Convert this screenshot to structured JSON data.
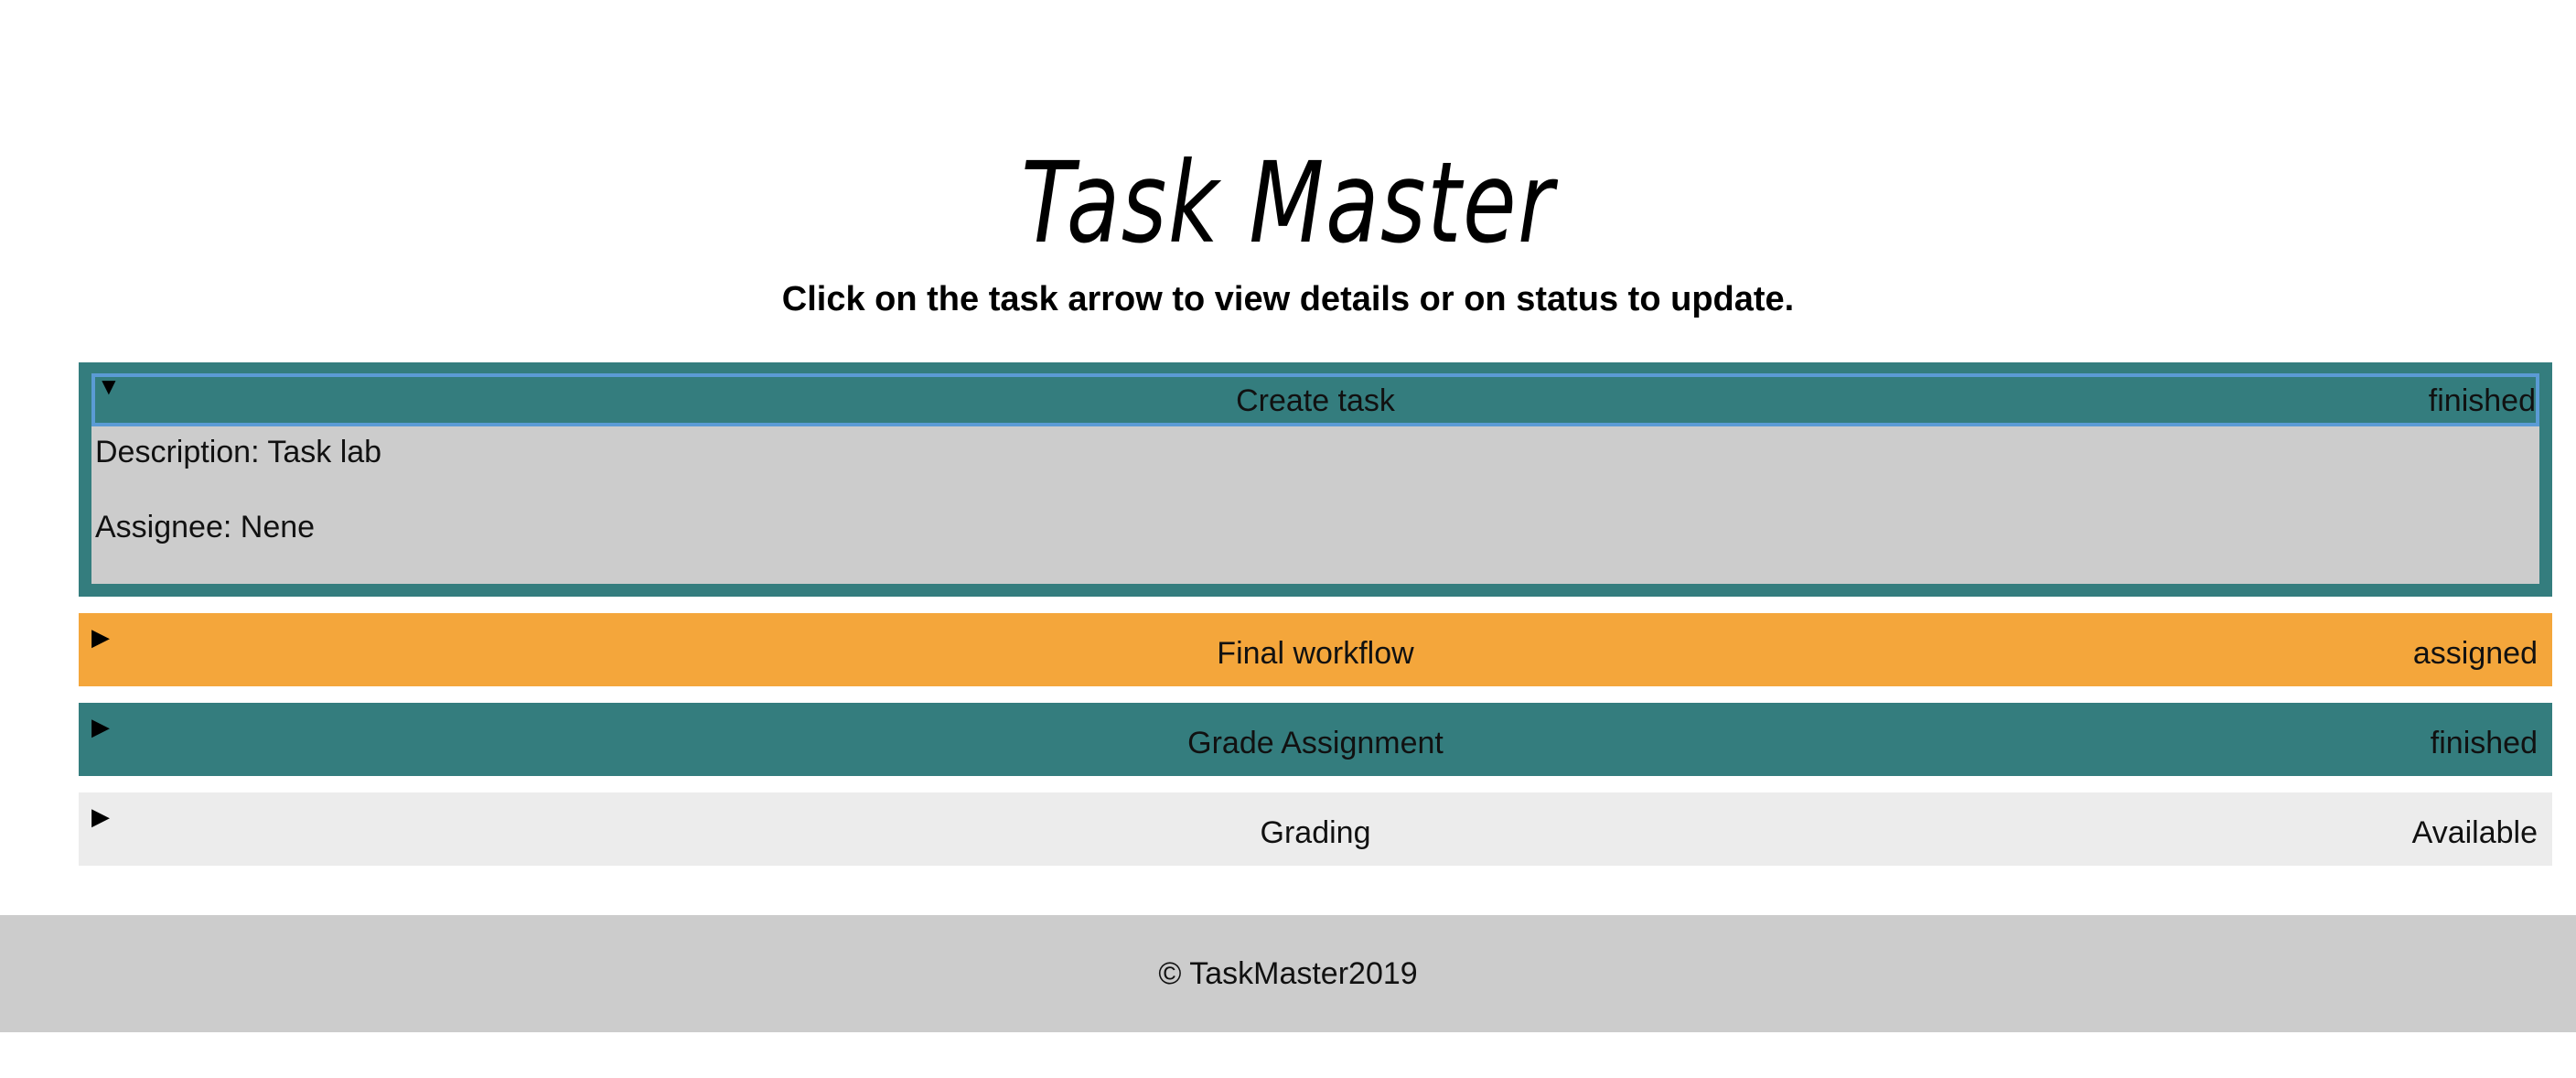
{
  "header": {
    "title": "Task Master",
    "instructions": "Click on the task arrow to view details or on status to update."
  },
  "tasks": [
    {
      "name": "Create task",
      "status": "finished",
      "arrow": "▼",
      "expanded": true,
      "color": "#347d7e",
      "description": "Description: Task lab",
      "assignee": "Assignee: Nene"
    },
    {
      "name": "Final workflow",
      "status": "assigned",
      "arrow": "▶",
      "expanded": false,
      "color": "#f4a63b"
    },
    {
      "name": "Grade Assignment",
      "status": "finished",
      "arrow": "▶",
      "expanded": false,
      "color": "#347d7e"
    },
    {
      "name": "Grading",
      "status": "Available",
      "arrow": "▶",
      "expanded": false,
      "color": "#ececec"
    }
  ],
  "colors": {
    "finished": "#347d7e",
    "assigned": "#f4a63b",
    "available": "#ececec",
    "details_bg": "#cccccc",
    "focus_outline": "#5b9bd5"
  },
  "footer": {
    "copyright": "© TaskMaster2019"
  }
}
